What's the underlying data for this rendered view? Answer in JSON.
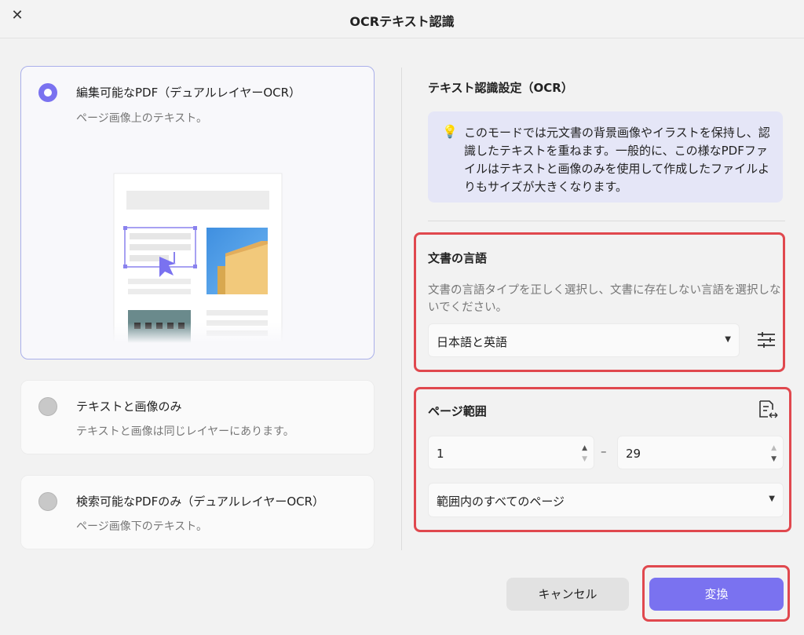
{
  "window": {
    "title": "OCRテキスト認識",
    "close_label": "✕"
  },
  "options": [
    {
      "title": "編集可能なPDF（デュアルレイヤーOCR）",
      "subtitle": "ページ画像上のテキスト。",
      "selected": true
    },
    {
      "title": "テキストと画像のみ",
      "subtitle": "テキストと画像は同じレイヤーにあります。",
      "selected": false
    },
    {
      "title": "検索可能なPDFのみ（デュアルレイヤーOCR）",
      "subtitle": "ページ画像下のテキスト。",
      "selected": false
    }
  ],
  "settings": {
    "heading": "テキスト認識設定（OCR）",
    "info": "このモードでは元文書の背景画像やイラストを保持し、認識したテキストを重ねます。一般的に、この様なPDFファイルはテキストと画像のみを使用して作成したファイルよりもサイズが大きくなります。"
  },
  "language": {
    "heading": "文書の言語",
    "description": "文書の言語タイプを正しく選択し、文書に存在しない言語を選択しないでください。",
    "selected": "日本語と英語"
  },
  "page_range": {
    "heading": "ページ範囲",
    "from": "1",
    "separator": "–",
    "to": "29",
    "scope": "範囲内のすべてのページ"
  },
  "buttons": {
    "cancel": "キャンセル",
    "convert": "変換"
  },
  "colors": {
    "accent": "#7a72f0",
    "highlight": "#e0484e",
    "info_bg": "#e5e6f7"
  }
}
